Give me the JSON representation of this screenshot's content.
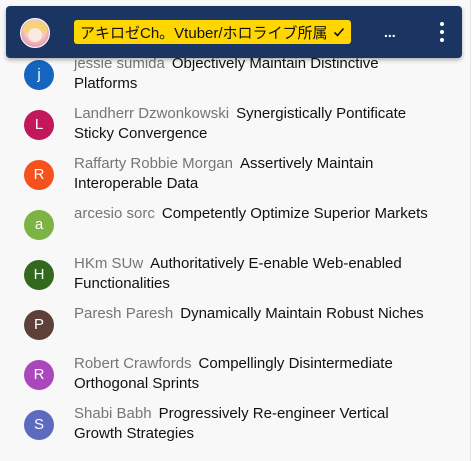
{
  "header": {
    "channel_name": "アキロゼCh。Vtuber/ホロライブ所属",
    "verified_icon": "check-icon",
    "ellipsis": "...",
    "menu_icon": "more-vert-icon",
    "background": "#1b3563",
    "chip_color": "#ffd600"
  },
  "messages": [
    {
      "author": "jessie sumida",
      "text": "Objectively Maintain Distinctive Platforms",
      "initial": "j",
      "color": "#1565c0"
    },
    {
      "author": "Landherr Dzwonkowski",
      "text": "Synergistically Pontificate Sticky Convergence",
      "initial": "L",
      "color": "#c2185b"
    },
    {
      "author": "Raffarty Robbie Morgan",
      "text": "Assertively Maintain Interoperable Data",
      "initial": "R",
      "color": "#f4511e"
    },
    {
      "author": "arcesio sorc",
      "text": "Competently Optimize Superior Markets",
      "initial": "a",
      "color": "#7cb342"
    },
    {
      "author": "HKm SUw",
      "text": "Authoritatively E-enable Web-enabled Functionalities",
      "initial": "H",
      "color": "#33691e"
    },
    {
      "author": "Paresh Paresh",
      "text": "Dynamically Maintain Robust Niches",
      "initial": "P",
      "color": "#5d4037"
    },
    {
      "author": "Robert Crawfords",
      "text": "Compellingly Disintermediate Orthogonal Sprints",
      "initial": "R",
      "color": "#ab47bc"
    },
    {
      "author": "Shabi Babh",
      "text": "Progressively Re-engineer Vertical Growth Strategies",
      "initial": "S",
      "color": "#5c6bc0"
    }
  ]
}
